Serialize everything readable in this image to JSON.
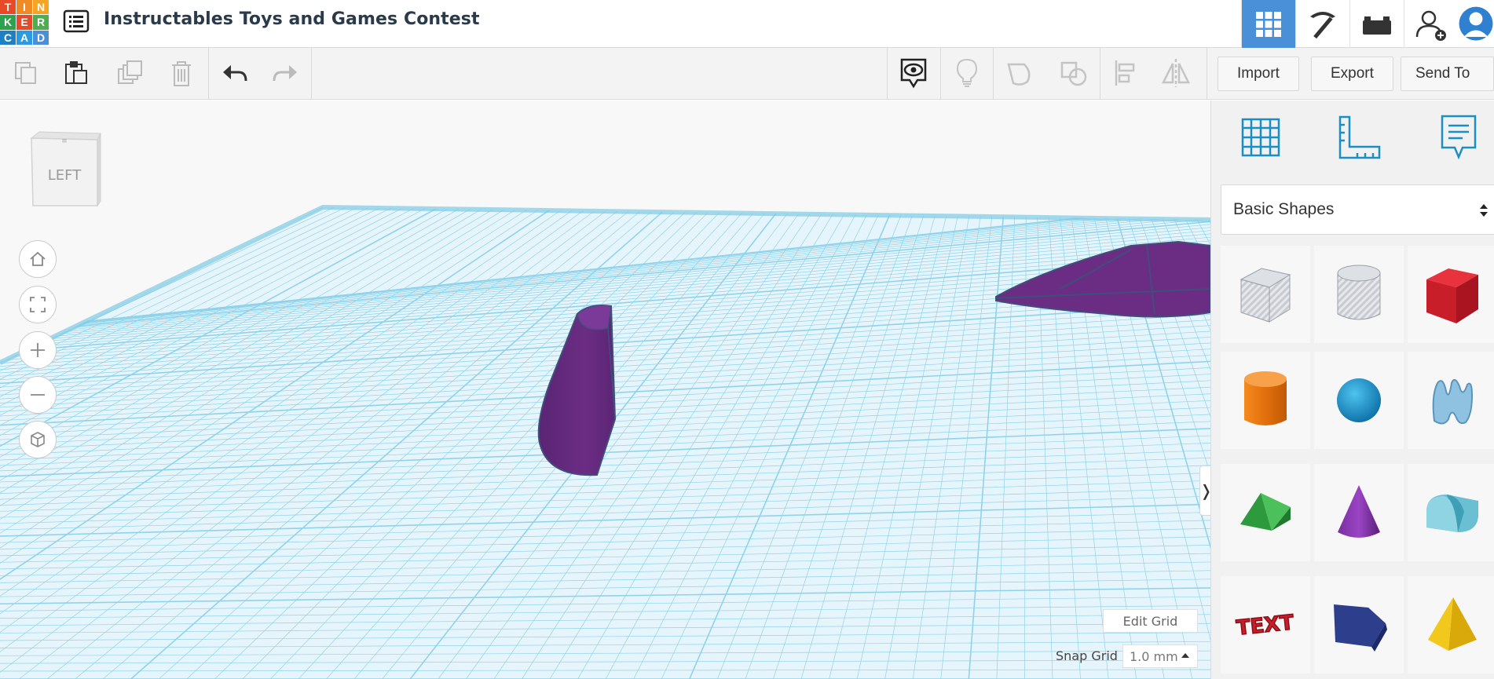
{
  "app": {
    "logo_letters": [
      "T",
      "I",
      "N",
      "K",
      "E",
      "R",
      "C",
      "A",
      "D"
    ],
    "logo_colors": [
      "#e84a27",
      "#f08a24",
      "#f5a524",
      "#2ba24c",
      "#e84a27",
      "#4cae4f",
      "#1d7fc4",
      "#2b9ae0",
      "#4a90d9"
    ],
    "title": "Instructables Toys and Games Contest"
  },
  "topbar": {
    "icons": [
      "3d-design-grid-icon",
      "pickaxe-icon",
      "brick-icon",
      "invite-user-icon",
      "user-avatar-icon"
    ],
    "accent": "#4a90d9"
  },
  "toolbar": {
    "left_icons": [
      "copy-icon",
      "paste-icon",
      "duplicate-icon",
      "delete-icon",
      "undo-icon",
      "redo-icon"
    ],
    "right_icons": [
      "show-hide-icon",
      "lightbulb-icon",
      "group-icon",
      "ungroup-icon",
      "align-icon",
      "mirror-icon"
    ],
    "import_label": "Import",
    "export_label": "Export",
    "send_to_label": "Send To"
  },
  "viewport": {
    "viewcube_label": "LEFT",
    "nav_icons": [
      "home-icon",
      "fit-view-icon",
      "zoom-in-icon",
      "zoom-out-icon",
      "perspective-icon"
    ],
    "edit_grid_label": "Edit Grid",
    "snap_grid_label": "Snap Grid",
    "snap_grid_value": "1.0 mm",
    "collapse_glyph": "❭",
    "grid_color": "#8fd3ea",
    "object_color": "#6b2d84"
  },
  "panel": {
    "top_icons": [
      "workplane-icon",
      "ruler-icon",
      "notes-icon"
    ],
    "category_label": "Basic Shapes",
    "shapes": [
      "box-hole-icon",
      "cylinder-hole-icon",
      "box-icon",
      "cylinder-icon",
      "sphere-icon",
      "scribble-icon",
      "roof-icon",
      "cone-icon",
      "round-roof-icon",
      "text-icon",
      "polygon-icon",
      "pyramid-icon"
    ],
    "shape_text_label": "TEXT"
  }
}
